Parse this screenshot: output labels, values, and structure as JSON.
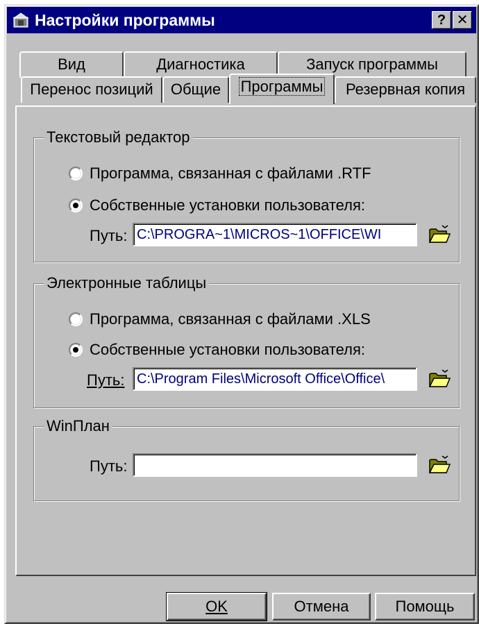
{
  "window": {
    "title": "Настройки программы",
    "help_button": "?",
    "close_button": "✕"
  },
  "tabs": {
    "row1": [
      "Вид",
      "Диагностика",
      "Запуск программы"
    ],
    "row2": [
      "Перенос позиций",
      "Общие",
      "Программы",
      "Резервная копия"
    ],
    "active": "Программы"
  },
  "text_editor": {
    "legend": "Текстовый редактор",
    "option1": "Программа, связанная с файлами .RTF",
    "option2": "Собственные установки пользователя:",
    "selected": "option2",
    "path_label": "Путь:",
    "path_value": "C:\\PROGRA~1\\MICROS~1\\OFFICE\\WI"
  },
  "spreadsheets": {
    "legend": "Электронные таблицы",
    "option1": "Программа, связанная с файлами .XLS",
    "option2": "Собственные установки пользователя:",
    "selected": "option2",
    "path_label": "Путь:",
    "path_value": "C:\\Program Files\\Microsoft Office\\Office\\"
  },
  "winplan": {
    "legend": "WinПлан",
    "path_label": "Путь:",
    "path_value": ""
  },
  "buttons": {
    "ok": "OK",
    "cancel": "Отмена",
    "help": "Помощь"
  },
  "icons": {
    "title": "settings-window-icon",
    "browse": "open-folder-icon"
  },
  "colors": {
    "titlebar": "#000080",
    "face": "#c0c0c0",
    "path_text": "#000080"
  }
}
